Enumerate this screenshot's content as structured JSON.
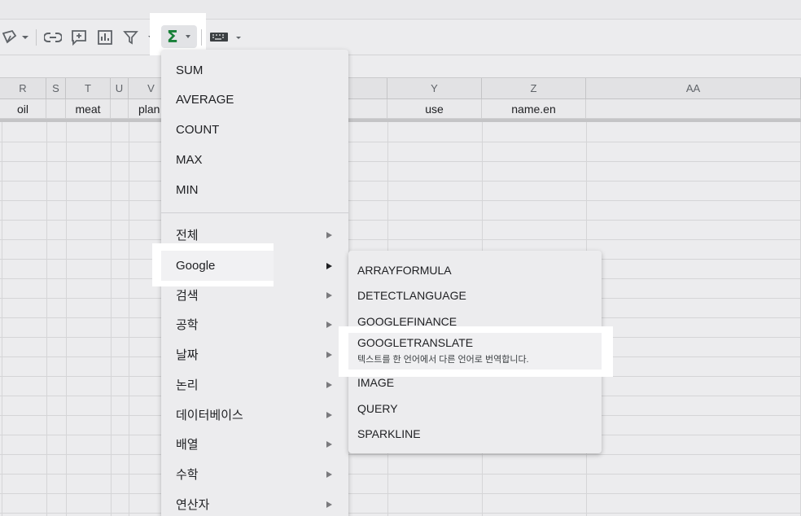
{
  "toolbar": {
    "icons": [
      "draw-icon",
      "link-icon",
      "comment-icon",
      "chart-icon",
      "filter-icon",
      "sigma-icon",
      "keyboard-icon"
    ],
    "sigma_glyph": "Σ",
    "accent_color": "#188038"
  },
  "grid": {
    "columns": [
      "R",
      "S",
      "T",
      "U",
      "V",
      "Y",
      "Z",
      "AA"
    ],
    "row1": {
      "R": "oil",
      "T": "meat",
      "V": "plan",
      "Y": "use",
      "Z": "name.en"
    }
  },
  "menu": {
    "quick_functions": [
      "SUM",
      "AVERAGE",
      "COUNT",
      "MAX",
      "MIN"
    ],
    "categories": [
      "전체",
      "Google",
      "검색",
      "공학",
      "날짜",
      "논리",
      "데이터베이스",
      "배열",
      "수학",
      "연산자"
    ],
    "active_category": "Google"
  },
  "submenu": {
    "items": [
      "ARRAYFORMULA",
      "DETECTLANGUAGE",
      "GOOGLEFINANCE",
      "GOOGLETRANSLATE",
      "IMAGE",
      "QUERY",
      "SPARKLINE"
    ],
    "selected": {
      "title": "GOOGLETRANSLATE",
      "description": "텍스트를 한 언어에서 다른 언어로 번역합니다."
    }
  }
}
